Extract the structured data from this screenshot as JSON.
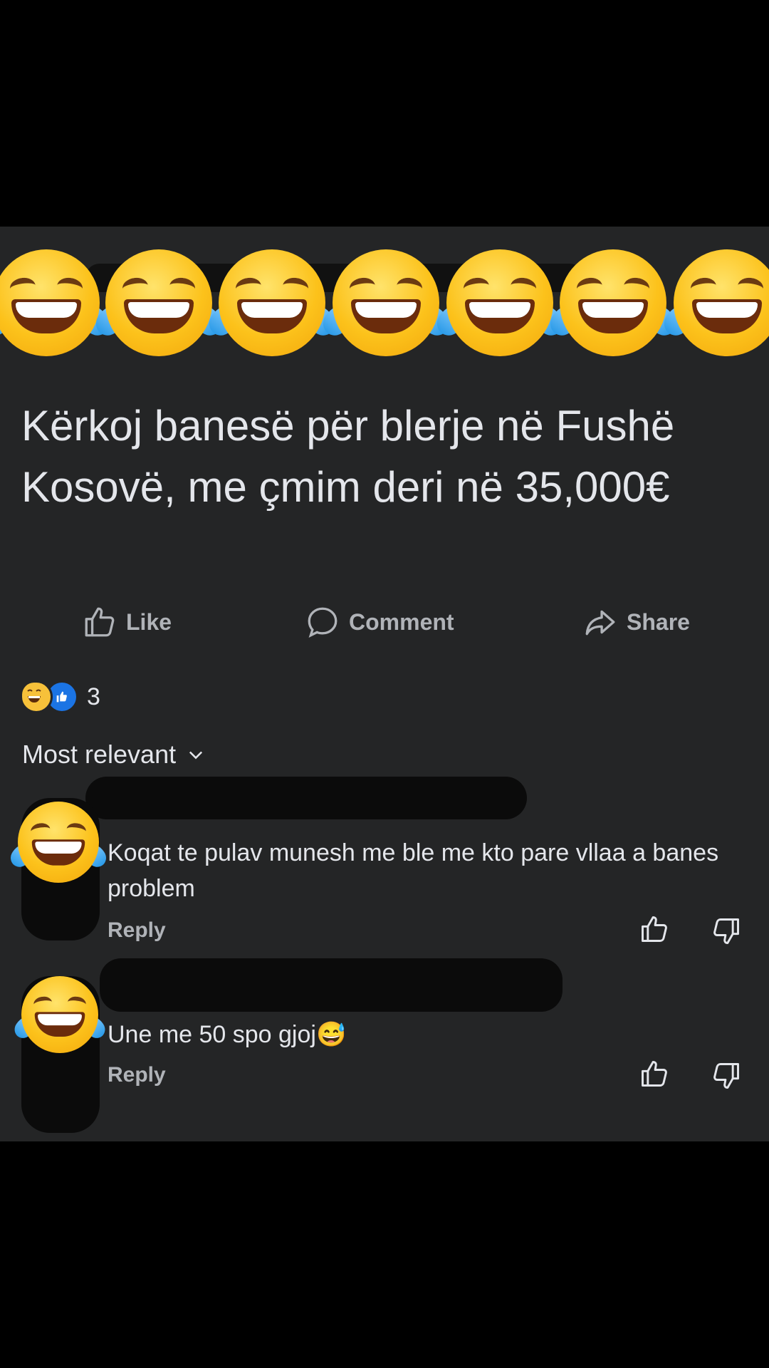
{
  "post": {
    "text": "Kërkoj banesë për blerje në Fushë Kosovë, me çmim deri në 35,000€"
  },
  "actions": {
    "like": "Like",
    "comment": "Comment",
    "share": "Share"
  },
  "reactions": {
    "count": "3",
    "icons": [
      "grinning-sweat-icon",
      "like-icon"
    ]
  },
  "sort": {
    "label": "Most relevant"
  },
  "comments": [
    {
      "text": "Koqat te pulav munesh me ble me kto pare vllaa a banes problem",
      "reply_label": "Reply"
    },
    {
      "text": "Une me 50 spo gjoj😅",
      "reply_label": "Reply"
    }
  ],
  "colors": {
    "background": "#000000",
    "panel": "#242526",
    "text": "#e4e6eb",
    "muted": "#b0b3b8",
    "like_blue": "#1b74e4"
  }
}
